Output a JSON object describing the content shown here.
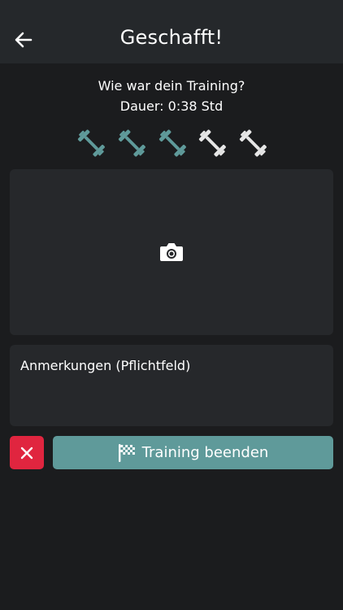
{
  "header": {
    "title": "Geschafft!",
    "back_icon": "arrow-left-icon"
  },
  "summary": {
    "question": "Wie war dein Training?",
    "duration": "Dauer: 0:38 Std"
  },
  "rating": {
    "value": 3,
    "max": 5,
    "active_color": "#5f9a9a",
    "inactive_color": "#e6e6e6"
  },
  "photo": {
    "icon": "camera-icon"
  },
  "notes": {
    "placeholder": "Anmerkungen (Pflichtfeld)"
  },
  "actions": {
    "cancel_icon": "close-icon",
    "finish_icon": "checkered-flag-icon",
    "finish_label": "Training beenden"
  },
  "colors": {
    "background": "#1b1c1e",
    "header": "#25282b",
    "card": "#26282b",
    "accent": "#5f9a9a",
    "danger": "#e0253f"
  }
}
